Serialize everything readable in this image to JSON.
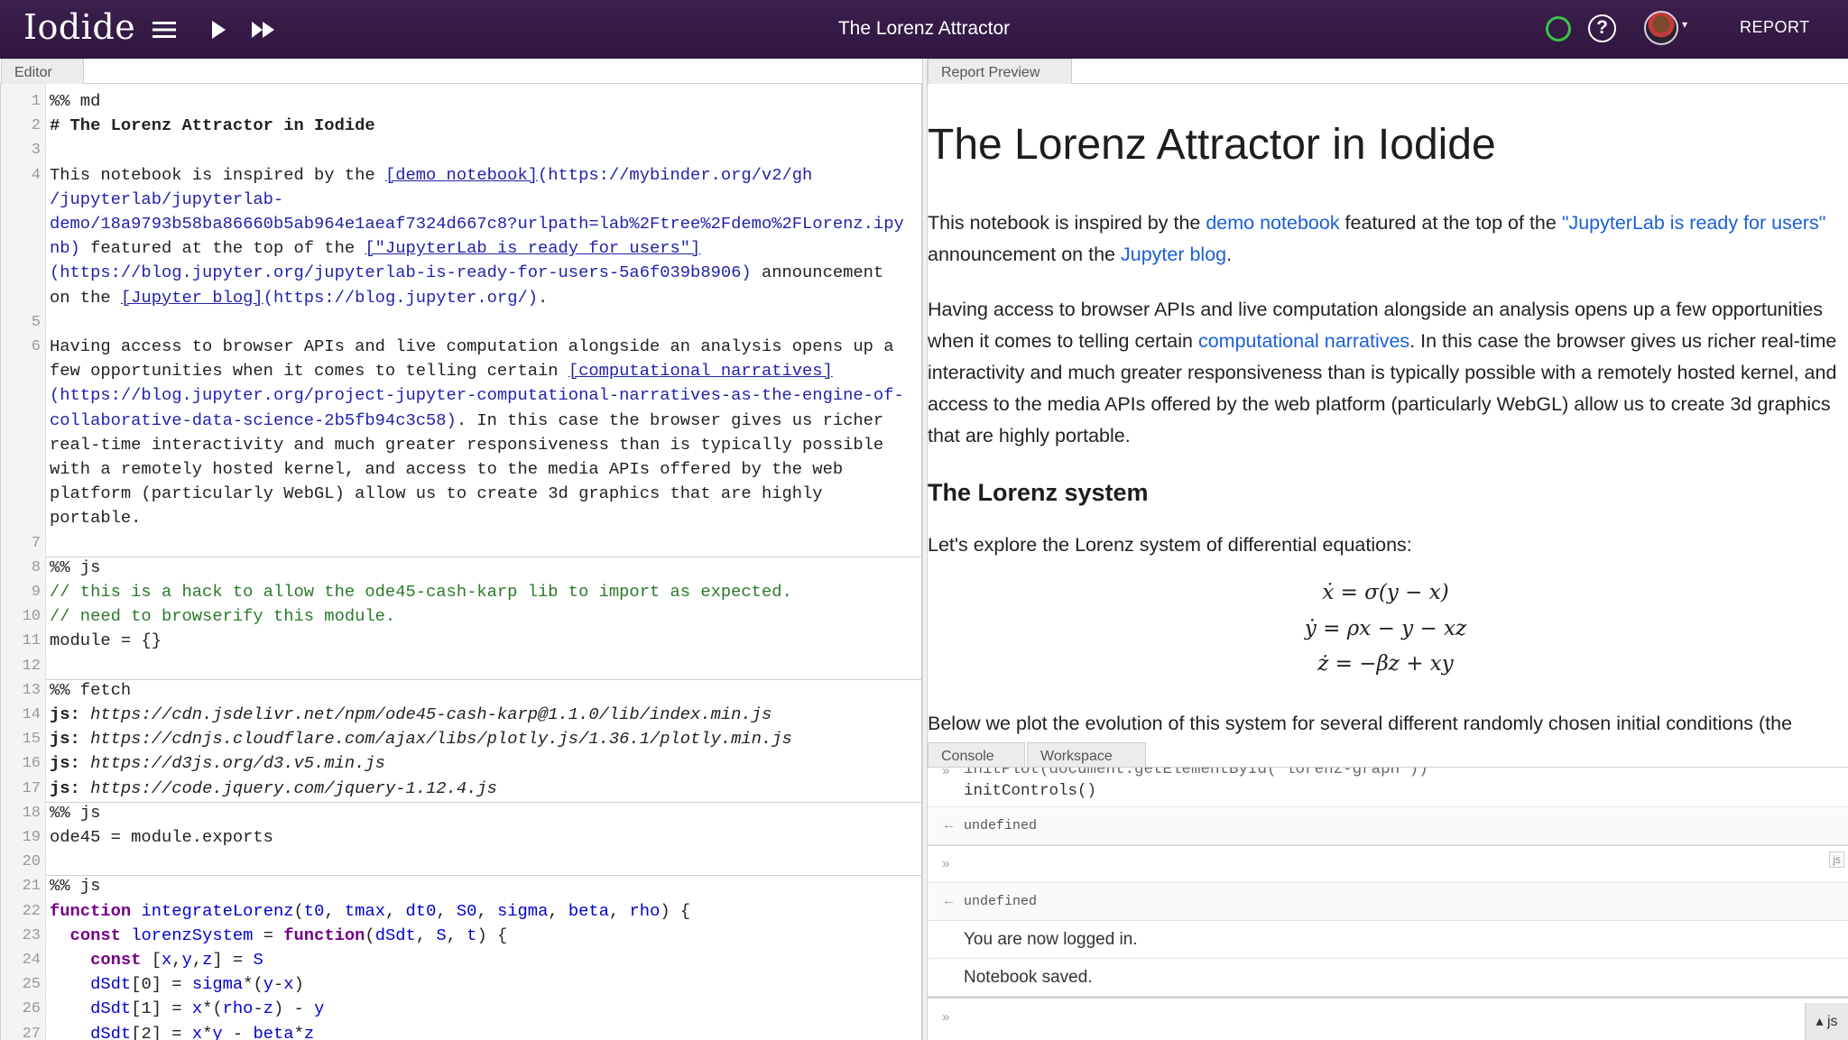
{
  "header": {
    "app_name": "Iodide",
    "notebook_title": "The Lorenz Attractor",
    "report_label": "REPORT",
    "menu_icon": "hamburger-icon",
    "run_icon": "play-icon",
    "run_all_icon": "fast-forward-icon",
    "status_color": "#3cc24a",
    "help_glyph": "?"
  },
  "tabs": {
    "editor": "Editor",
    "report_preview": "Report Preview",
    "console": "Console",
    "workspace": "Workspace"
  },
  "editor": {
    "lines": [
      {
        "n": "1",
        "text": "%% md"
      },
      {
        "n": "2",
        "text": "# The Lorenz Attractor in Iodide"
      },
      {
        "n": "3",
        "text": ""
      },
      {
        "n": "4",
        "segments": [
          [
            "This notebook is inspired by the ",
            ""
          ],
          [
            "[demo notebook]",
            "link"
          ],
          [
            "(https://mybinder.org/v2/gh",
            "url"
          ]
        ]
      },
      {
        "n": "",
        "segments": [
          [
            "/jupyterlab/jupyterlab-",
            "url"
          ]
        ]
      },
      {
        "n": "",
        "segments": [
          [
            "demo/18a9793b58ba86660b5ab964e1aeaf7324d667c8?urlpath=lab%2Ftree%2Fdemo%2FLorenz.ipy",
            "url"
          ]
        ]
      },
      {
        "n": "",
        "segments": [
          [
            "nb)",
            "url"
          ],
          [
            " featured at the top of the ",
            ""
          ],
          [
            "[\"JupyterLab is ready for users\"]",
            "link"
          ]
        ]
      },
      {
        "n": "",
        "segments": [
          [
            "(https://blog.jupyter.org/jupyterlab-is-ready-for-users-5a6f039b8906)",
            "url"
          ],
          [
            " announcement",
            ""
          ]
        ]
      },
      {
        "n": "",
        "segments": [
          [
            "on the ",
            ""
          ],
          [
            "[Jupyter blog]",
            "link"
          ],
          [
            "(https://blog.jupyter.org/)",
            "url"
          ],
          [
            ".",
            ""
          ]
        ]
      },
      {
        "n": "5",
        "text": ""
      },
      {
        "n": "6",
        "text": "Having access to browser APIs and live computation alongside an analysis opens up a"
      },
      {
        "n": "",
        "segments": [
          [
            "few opportunities when it comes to telling certain ",
            ""
          ],
          [
            "[computational narratives]",
            "link"
          ]
        ]
      },
      {
        "n": "",
        "segments": [
          [
            "(https://blog.jupyter.org/project-jupyter-computational-narratives-as-the-engine-of-",
            "url"
          ]
        ]
      },
      {
        "n": "",
        "segments": [
          [
            "collaborative-data-science-2b5fb94c3c58)",
            "url"
          ],
          [
            ". In this case the browser gives us richer",
            ""
          ]
        ]
      },
      {
        "n": "",
        "text": "real-time interactivity and much greater responsiveness than is typically possible"
      },
      {
        "n": "",
        "text": "with a remotely hosted kernel, and access to the media APIs offered by the web"
      },
      {
        "n": "",
        "text": "platform (particularly WebGL) allow us to create 3d graphics that are highly"
      },
      {
        "n": "",
        "text": "portable."
      },
      {
        "n": "7",
        "text": ""
      },
      {
        "n": "8",
        "text": "%% js"
      },
      {
        "n": "9",
        "segments": [
          [
            "// this is a hack to allow the ode45-cash-karp lib to import as expected.",
            "comment"
          ]
        ]
      },
      {
        "n": "10",
        "segments": [
          [
            "// need to browserify this module.",
            "comment"
          ]
        ]
      },
      {
        "n": "11",
        "text": "module = {}"
      },
      {
        "n": "12",
        "text": ""
      },
      {
        "n": "13",
        "text": "%% fetch"
      },
      {
        "n": "14",
        "segments": [
          [
            "js: ",
            "b"
          ],
          [
            "https://cdn.jsdelivr.net/npm/ode45-cash-karp@1.1.0/lib/index.min.js",
            "i"
          ]
        ]
      },
      {
        "n": "15",
        "segments": [
          [
            "js: ",
            "b"
          ],
          [
            "https://cdnjs.cloudflare.com/ajax/libs/plotly.js/1.36.1/plotly.min.js",
            "i"
          ]
        ]
      },
      {
        "n": "16",
        "segments": [
          [
            "js: ",
            "b"
          ],
          [
            "https://d3js.org/d3.v5.min.js",
            "i"
          ]
        ]
      },
      {
        "n": "17",
        "segments": [
          [
            "js: ",
            "b"
          ],
          [
            "https://code.jquery.com/jquery-1.12.4.js",
            "i"
          ]
        ]
      },
      {
        "n": "18",
        "text": "%% js"
      },
      {
        "n": "19",
        "text": "ode45 = module.exports"
      },
      {
        "n": "20",
        "text": ""
      },
      {
        "n": "21",
        "text": "%% js"
      },
      {
        "n": "22",
        "segments": [
          [
            "function",
            "kw"
          ],
          [
            " ",
            ""
          ],
          [
            "integrateLorenz",
            "var"
          ],
          [
            "(",
            ""
          ],
          [
            "t0",
            "var"
          ],
          [
            ", ",
            ""
          ],
          [
            "tmax",
            "var"
          ],
          [
            ", ",
            ""
          ],
          [
            "dt0",
            "var"
          ],
          [
            ", ",
            ""
          ],
          [
            "S0",
            "var"
          ],
          [
            ", ",
            ""
          ],
          [
            "sigma",
            "var"
          ],
          [
            ", ",
            ""
          ],
          [
            "beta",
            "var"
          ],
          [
            ", ",
            ""
          ],
          [
            "rho",
            "var"
          ],
          [
            ") {",
            ""
          ]
        ]
      },
      {
        "n": "23",
        "segments": [
          [
            "  ",
            ""
          ],
          [
            "const",
            "kw"
          ],
          [
            " ",
            ""
          ],
          [
            "lorenzSystem",
            "var"
          ],
          [
            " = ",
            ""
          ],
          [
            "function",
            "kw"
          ],
          [
            "(",
            ""
          ],
          [
            "dSdt",
            "var"
          ],
          [
            ", ",
            ""
          ],
          [
            "S",
            "var"
          ],
          [
            ", ",
            ""
          ],
          [
            "t",
            "var"
          ],
          [
            ") {",
            ""
          ]
        ]
      },
      {
        "n": "24",
        "segments": [
          [
            "    ",
            ""
          ],
          [
            "const",
            "kw"
          ],
          [
            " [",
            ""
          ],
          [
            "x",
            "var"
          ],
          [
            ",",
            ""
          ],
          [
            "y",
            "var"
          ],
          [
            ",",
            ""
          ],
          [
            "z",
            "var"
          ],
          [
            "] = ",
            ""
          ],
          [
            "S",
            "var"
          ]
        ]
      },
      {
        "n": "25",
        "segments": [
          [
            "    ",
            ""
          ],
          [
            "dSdt",
            "var"
          ],
          [
            "[0] = ",
            ""
          ],
          [
            "sigma",
            "var"
          ],
          [
            "*(",
            ""
          ],
          [
            "y",
            "var"
          ],
          [
            "-",
            ""
          ],
          [
            "x",
            "var"
          ],
          [
            ")",
            ""
          ]
        ]
      },
      {
        "n": "26",
        "segments": [
          [
            "    ",
            ""
          ],
          [
            "dSdt",
            "var"
          ],
          [
            "[1] = ",
            ""
          ],
          [
            "x",
            "var"
          ],
          [
            "*(",
            ""
          ],
          [
            "rho",
            "var"
          ],
          [
            "-",
            ""
          ],
          [
            "z",
            "var"
          ],
          [
            ") - ",
            ""
          ],
          [
            "y",
            "var"
          ]
        ]
      },
      {
        "n": "27",
        "segments": [
          [
            "    ",
            ""
          ],
          [
            "dSdt",
            "var"
          ],
          [
            "[2] = ",
            ""
          ],
          [
            "x",
            "var"
          ],
          [
            "*",
            ""
          ],
          [
            "y",
            "var"
          ],
          [
            " - ",
            ""
          ],
          [
            "beta",
            "var"
          ],
          [
            "*",
            ""
          ],
          [
            "z",
            "var"
          ]
        ]
      }
    ]
  },
  "report": {
    "h1": "The Lorenz Attractor in Iodide",
    "p1": {
      "a": "This notebook is inspired by the ",
      "link1": "demo notebook",
      "b": " featured at the top of the ",
      "link2": "\"JupyterLab is ready for users\"",
      "c": " announcement on the ",
      "link3": "Jupyter blog",
      "d": "."
    },
    "p2": {
      "a": "Having access to browser APIs and live computation alongside an analysis opens up a few opportunities when it comes to telling certain ",
      "link": "computational narratives",
      "b": ". In this case the browser gives us richer real-time interactivity and much greater responsiveness than is typically possible with a remotely hosted kernel, and access to the media APIs offered by the web platform (particularly WebGL) allow us to create 3d graphics that are highly portable."
    },
    "h3": "The Lorenz system",
    "p3": "Let's explore the Lorenz system of differential equations:",
    "equations": [
      "ẋ = σ(y − x)",
      "ẏ = ρx − y − xz",
      "ż = −βz + xy"
    ],
    "p4": "Below we plot the evolution of this system for several different randomly chosen initial conditions (the"
  },
  "console": {
    "partial_code": "initPlot(document.getElementById('lorenz-graph'))",
    "code_line": "initControls()",
    "output_arrow": "←",
    "input_arrow": "»",
    "undefined1": "undefined",
    "undefined2": "undefined",
    "msg1": "You are now logged in.",
    "msg2": "Notebook saved.",
    "js_badge": "js",
    "lang_button": "▴ js"
  }
}
